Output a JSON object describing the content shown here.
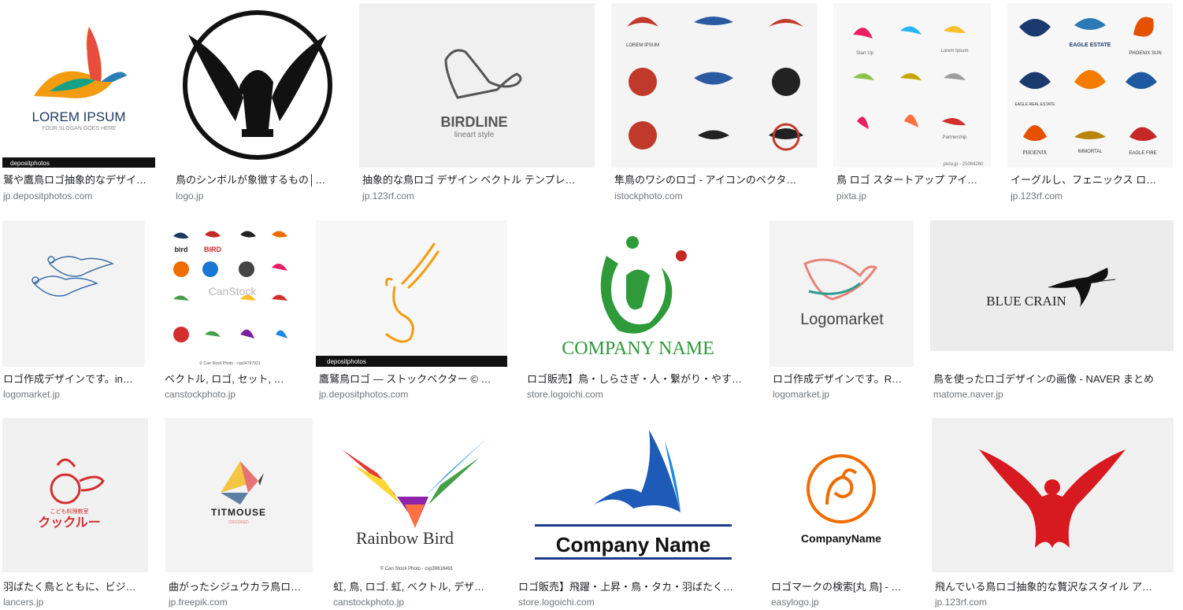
{
  "results": [
    {
      "caption": "鷲や鷹鳥ロゴ抽象的なデザイ…",
      "source": "jp.depositphotos.com",
      "thumb": {
        "lines": [
          "LOREM IPSUM",
          "YOUR SLOGAN GOES HERE"
        ],
        "bar": "depositphotos"
      }
    },
    {
      "caption": "鳥のシンボルが象徴するもの│…",
      "source": "logo.jp",
      "thumb": {
        "lines": []
      }
    },
    {
      "caption": "抽象的な鳥ロゴ デザイン ベクトル テンプレ…",
      "source": "jp.123rf.com",
      "thumb": {
        "lines": [
          "BIRDLINE",
          "lineart style"
        ]
      }
    },
    {
      "caption": "隼鳥のワシのロゴ - アイコンのベクタ…",
      "source": "istockphoto.com",
      "thumb": {
        "lines": [
          "LOREM IPSUM"
        ]
      }
    },
    {
      "caption": "鳥 ロゴ スタートアップ アイ…",
      "source": "pixta.jp",
      "thumb": {
        "lines": [
          "Start Up",
          "Lorem Ipsum",
          "Partnership",
          "pixta.jp - 25064260"
        ]
      }
    },
    {
      "caption": "イーグルし、フェニックス ロ…",
      "source": "jp.123rf.com",
      "thumb": {
        "lines": [
          "EAGLE ESTATE",
          "PHOENIX SUN",
          "PHOENIX",
          "EAGLE REAL ESTATE",
          "IMMORTAL",
          "EAGLE FIRE"
        ]
      }
    },
    {
      "caption": "ロゴ作成デザインです。in…",
      "source": "logomarket.jp",
      "thumb": {
        "lines": []
      }
    },
    {
      "caption": "ベクトル, ロゴ, セット, …",
      "source": "canstockphoto.jp",
      "thumb": {
        "lines": [
          "bird",
          "BIRD",
          "CanStock",
          "© Can Stock Photo - csp24797921"
        ]
      }
    },
    {
      "caption": "鷹鷲鳥ロゴ — ストックベクター © …",
      "source": "jp.depositphotos.com",
      "thumb": {
        "lines": [],
        "bar": "depositphotos"
      }
    },
    {
      "caption": "ロゴ販売】鳥・しらさぎ・人・繋がり・やす…",
      "source": "store.logoichi.com",
      "thumb": {
        "lines": [
          "COMPANY   NAME"
        ]
      }
    },
    {
      "caption": "ロゴ作成デザインです。R…",
      "source": "logomarket.jp",
      "thumb": {
        "lines": [
          "Logomarket"
        ]
      }
    },
    {
      "caption": "鳥を使ったロゴデザインの画像 - NAVER まとめ",
      "source": "matome.naver.jp",
      "thumb": {
        "lines": [
          "BLUE CRAIN"
        ]
      }
    },
    {
      "caption": "羽ばたく鳥とともに、ビジ…",
      "source": "lancers.jp",
      "thumb": {
        "lines": [
          "こども料理教室",
          "クックルー"
        ]
      }
    },
    {
      "caption": "曲がったシジュウカラ鳥ロ…",
      "source": "jp.freepik.com",
      "thumb": {
        "lines": [
          "TITMOUSE",
          "CROOKED"
        ]
      }
    },
    {
      "caption": "虹, 鳥, ロゴ. 虹, ベクトル, デザ…",
      "source": "canstockphoto.jp",
      "thumb": {
        "lines": [
          "Rainbow Bird",
          "© Can Stock Photo - csp39616491"
        ]
      }
    },
    {
      "caption": "ロゴ販売】飛躍・上昇・鳥・タカ・羽ばたく…",
      "source": "store.logoichi.com",
      "thumb": {
        "lines": [
          "Company  Name"
        ]
      }
    },
    {
      "caption": "ロゴマークの検索[丸 鳥] - …",
      "source": "easylogo.jp",
      "thumb": {
        "lines": [
          "CompanyName"
        ]
      }
    },
    {
      "caption": "飛んでいる鳥ロゴ抽象的な贅沢なスタイル ア…",
      "source": "jp.123rf.com",
      "thumb": {
        "lines": []
      }
    }
  ]
}
